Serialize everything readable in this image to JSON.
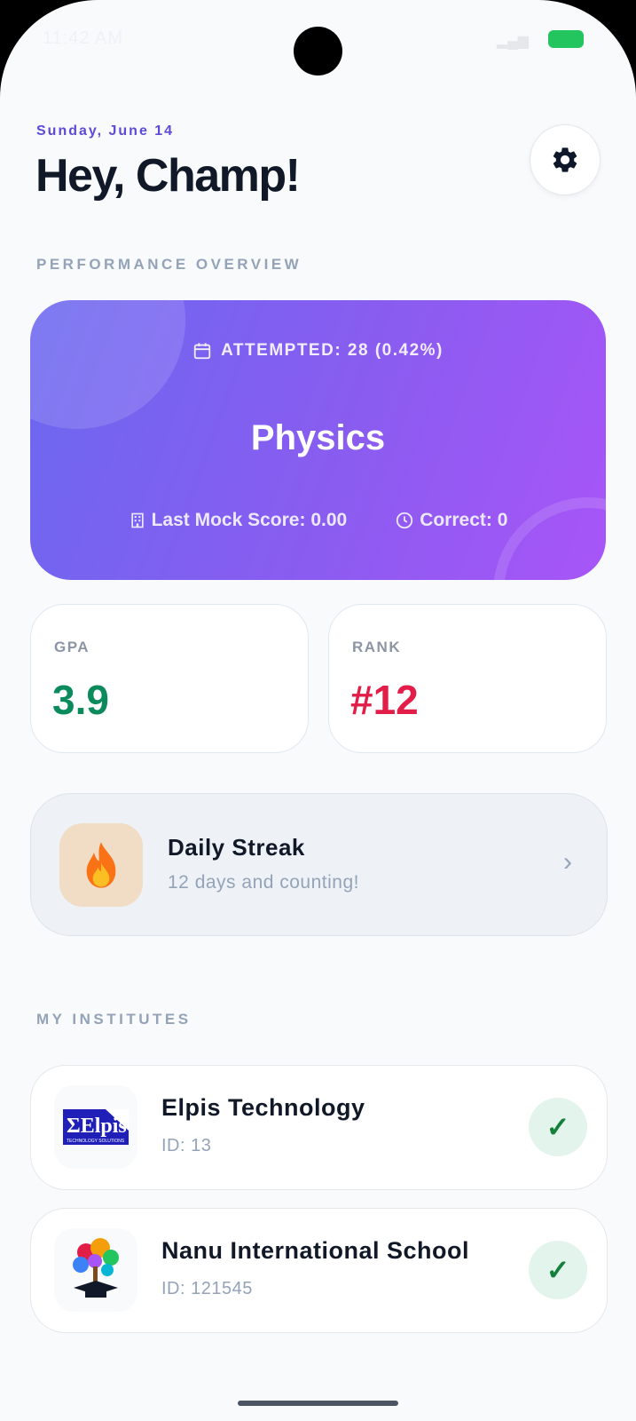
{
  "status_bar": {
    "time": "11:42 AM"
  },
  "header": {
    "date": "Sunday, June 14",
    "greeting": "Hey, Champ!",
    "settings_icon": "gear-icon"
  },
  "performance": {
    "section_label": "PERFORMANCE OVERVIEW",
    "attempted": "ATTEMPTED: 28 (0.42%)",
    "subject": "Physics",
    "last_mock_score": "Last Mock Score: 0.00",
    "correct": "Correct: 0",
    "gradient_start": "#6b68ef",
    "gradient_end": "#a855f7"
  },
  "metrics": [
    {
      "label": "GPA",
      "value": "3.9",
      "color": "#0b8a5c"
    },
    {
      "label": "RANK",
      "value": "#12",
      "color": "#e11d48"
    }
  ],
  "streak": {
    "title": "Daily Streak",
    "subtitle": "12 days and counting!",
    "icon": "fire-icon"
  },
  "institutes": {
    "section_label": "MY INSTITUTES",
    "items": [
      {
        "name": "Elpis Technology",
        "id": "ID: 13",
        "logo_text": "Elpis",
        "logo_caption": "TECHNOLOGY SOLUTIONS",
        "verified_icon": "check-icon"
      },
      {
        "name": "Nanu International School",
        "id": "ID: 121545",
        "verified_icon": "check-icon"
      }
    ]
  }
}
